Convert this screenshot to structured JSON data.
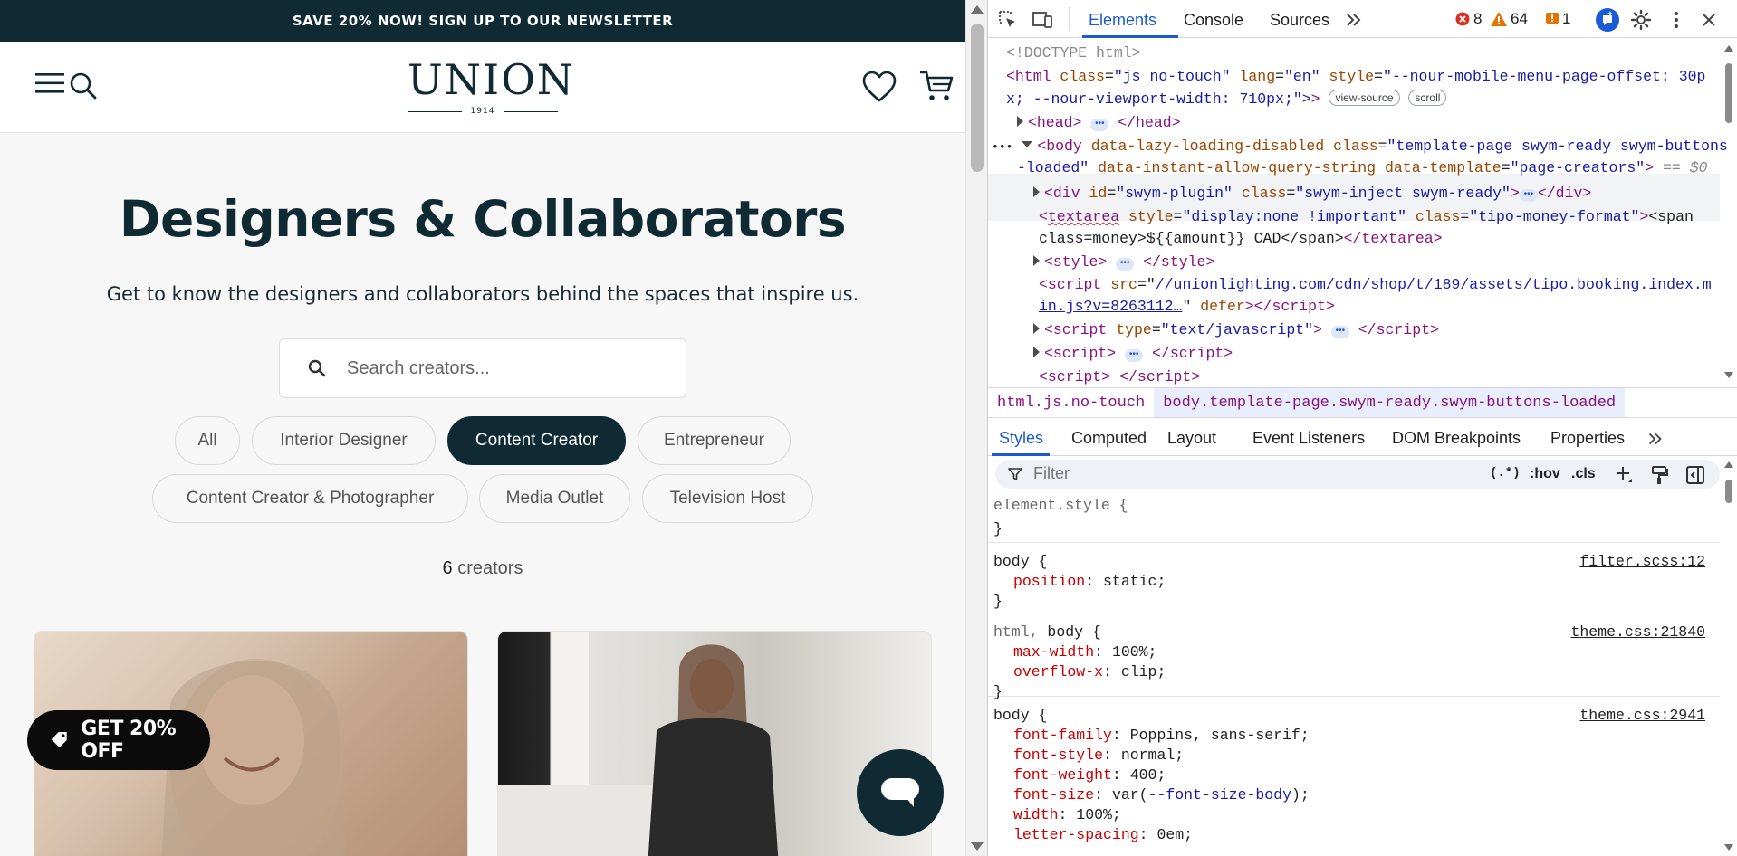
{
  "site": {
    "announcement": "SAVE 20% NOW! SIGN UP TO OUR NEWSLETTER",
    "logo": {
      "word": "UNION",
      "year": "1914"
    },
    "hero": {
      "title": "Designers & Collaborators",
      "subtitle": "Get to know the designers and collaborators behind the spaces that inspire us."
    },
    "search": {
      "placeholder": "Search creators..."
    },
    "filters": [
      {
        "label": "All",
        "active": false
      },
      {
        "label": "Interior Designer",
        "active": false
      },
      {
        "label": "Content Creator",
        "active": true
      },
      {
        "label": "Entrepreneur",
        "active": false
      },
      {
        "label": "Content Creator & Photographer",
        "active": false
      },
      {
        "label": "Media Outlet",
        "active": false
      },
      {
        "label": "Television Host",
        "active": false
      }
    ],
    "count": {
      "number": "6",
      "label": "creators"
    },
    "promo_badge": "GET 20% OFF",
    "colors": {
      "brand_dark": "#0f2a33",
      "background": "#f7f7f7"
    }
  },
  "devtools": {
    "tabs": [
      "Elements",
      "Console",
      "Sources"
    ],
    "active_tab": "Elements",
    "errors": "8",
    "warnings": "64",
    "issues": "1",
    "dom": {
      "doctype": "<!DOCTYPE html>",
      "html_open_1": "x; --nour-viewport-width: 710px;\">",
      "html_style_value": "\"--nour-mobile-menu-page-offset: 30p",
      "pill_view_source": "view-source",
      "pill_scroll": "scroll",
      "body_class_value_1": "\"template-page swym-ready swym-buttons",
      "body_class_value_2": "-loaded\"",
      "body_template_value": "\"page-creators\"",
      "body_marker": "== $0",
      "div_id_value": "\"swym-plugin\"",
      "div_class_value": "\"swym-inject swym-ready\"",
      "textarea_style_value": "\"display:none !important\"",
      "textarea_class_value": "\"tipo-money-format\"",
      "textarea_text_2": "class=money>${{amount}} CAD</span>",
      "script_src_1": "//unionlighting.com/cdn/shop/t/189/assets/tipo.booking.index.m",
      "script_src_2": "in.js?v=8263112…",
      "script_type_value": "\"text/javascript\""
    },
    "breadcrumbs": [
      "html.js.no-touch",
      "body.template-page.swym-ready.swym-buttons-loaded"
    ],
    "style_tabs": [
      "Styles",
      "Computed",
      "Layout",
      "Event Listeners",
      "DOM Breakpoints",
      "Properties"
    ],
    "filter": {
      "placeholder": "Filter",
      "regex": "(.*)",
      "hov": ":hov",
      "cls": ".cls"
    },
    "rules": [
      {
        "selector": "element.style {",
        "source": "",
        "decls": []
      },
      {
        "selector": "body {",
        "source": "filter.scss:12",
        "decls": [
          {
            "p": "position",
            "v": "static;"
          }
        ]
      },
      {
        "selector": "body {",
        "selector_prefix": "html, ",
        "source": "theme.css:21840",
        "decls": [
          {
            "p": "max-width",
            "v": "100%;"
          },
          {
            "p": "overflow-x",
            "v": "clip;"
          }
        ]
      },
      {
        "selector": "body {",
        "source": "theme.css:2941",
        "decls": [
          {
            "p": "font-family",
            "v": "Poppins, sans-serif;"
          },
          {
            "p": "font-style",
            "v": "normal;"
          },
          {
            "p": "font-weight",
            "v": "400;"
          },
          {
            "p": "font-size",
            "v_prefix": "var(",
            "v_var": "--font-size-body",
            "v": ");"
          },
          {
            "p": "width",
            "v": "100%;"
          },
          {
            "p": "letter-spacing",
            "v": "0em;"
          }
        ]
      }
    ]
  }
}
